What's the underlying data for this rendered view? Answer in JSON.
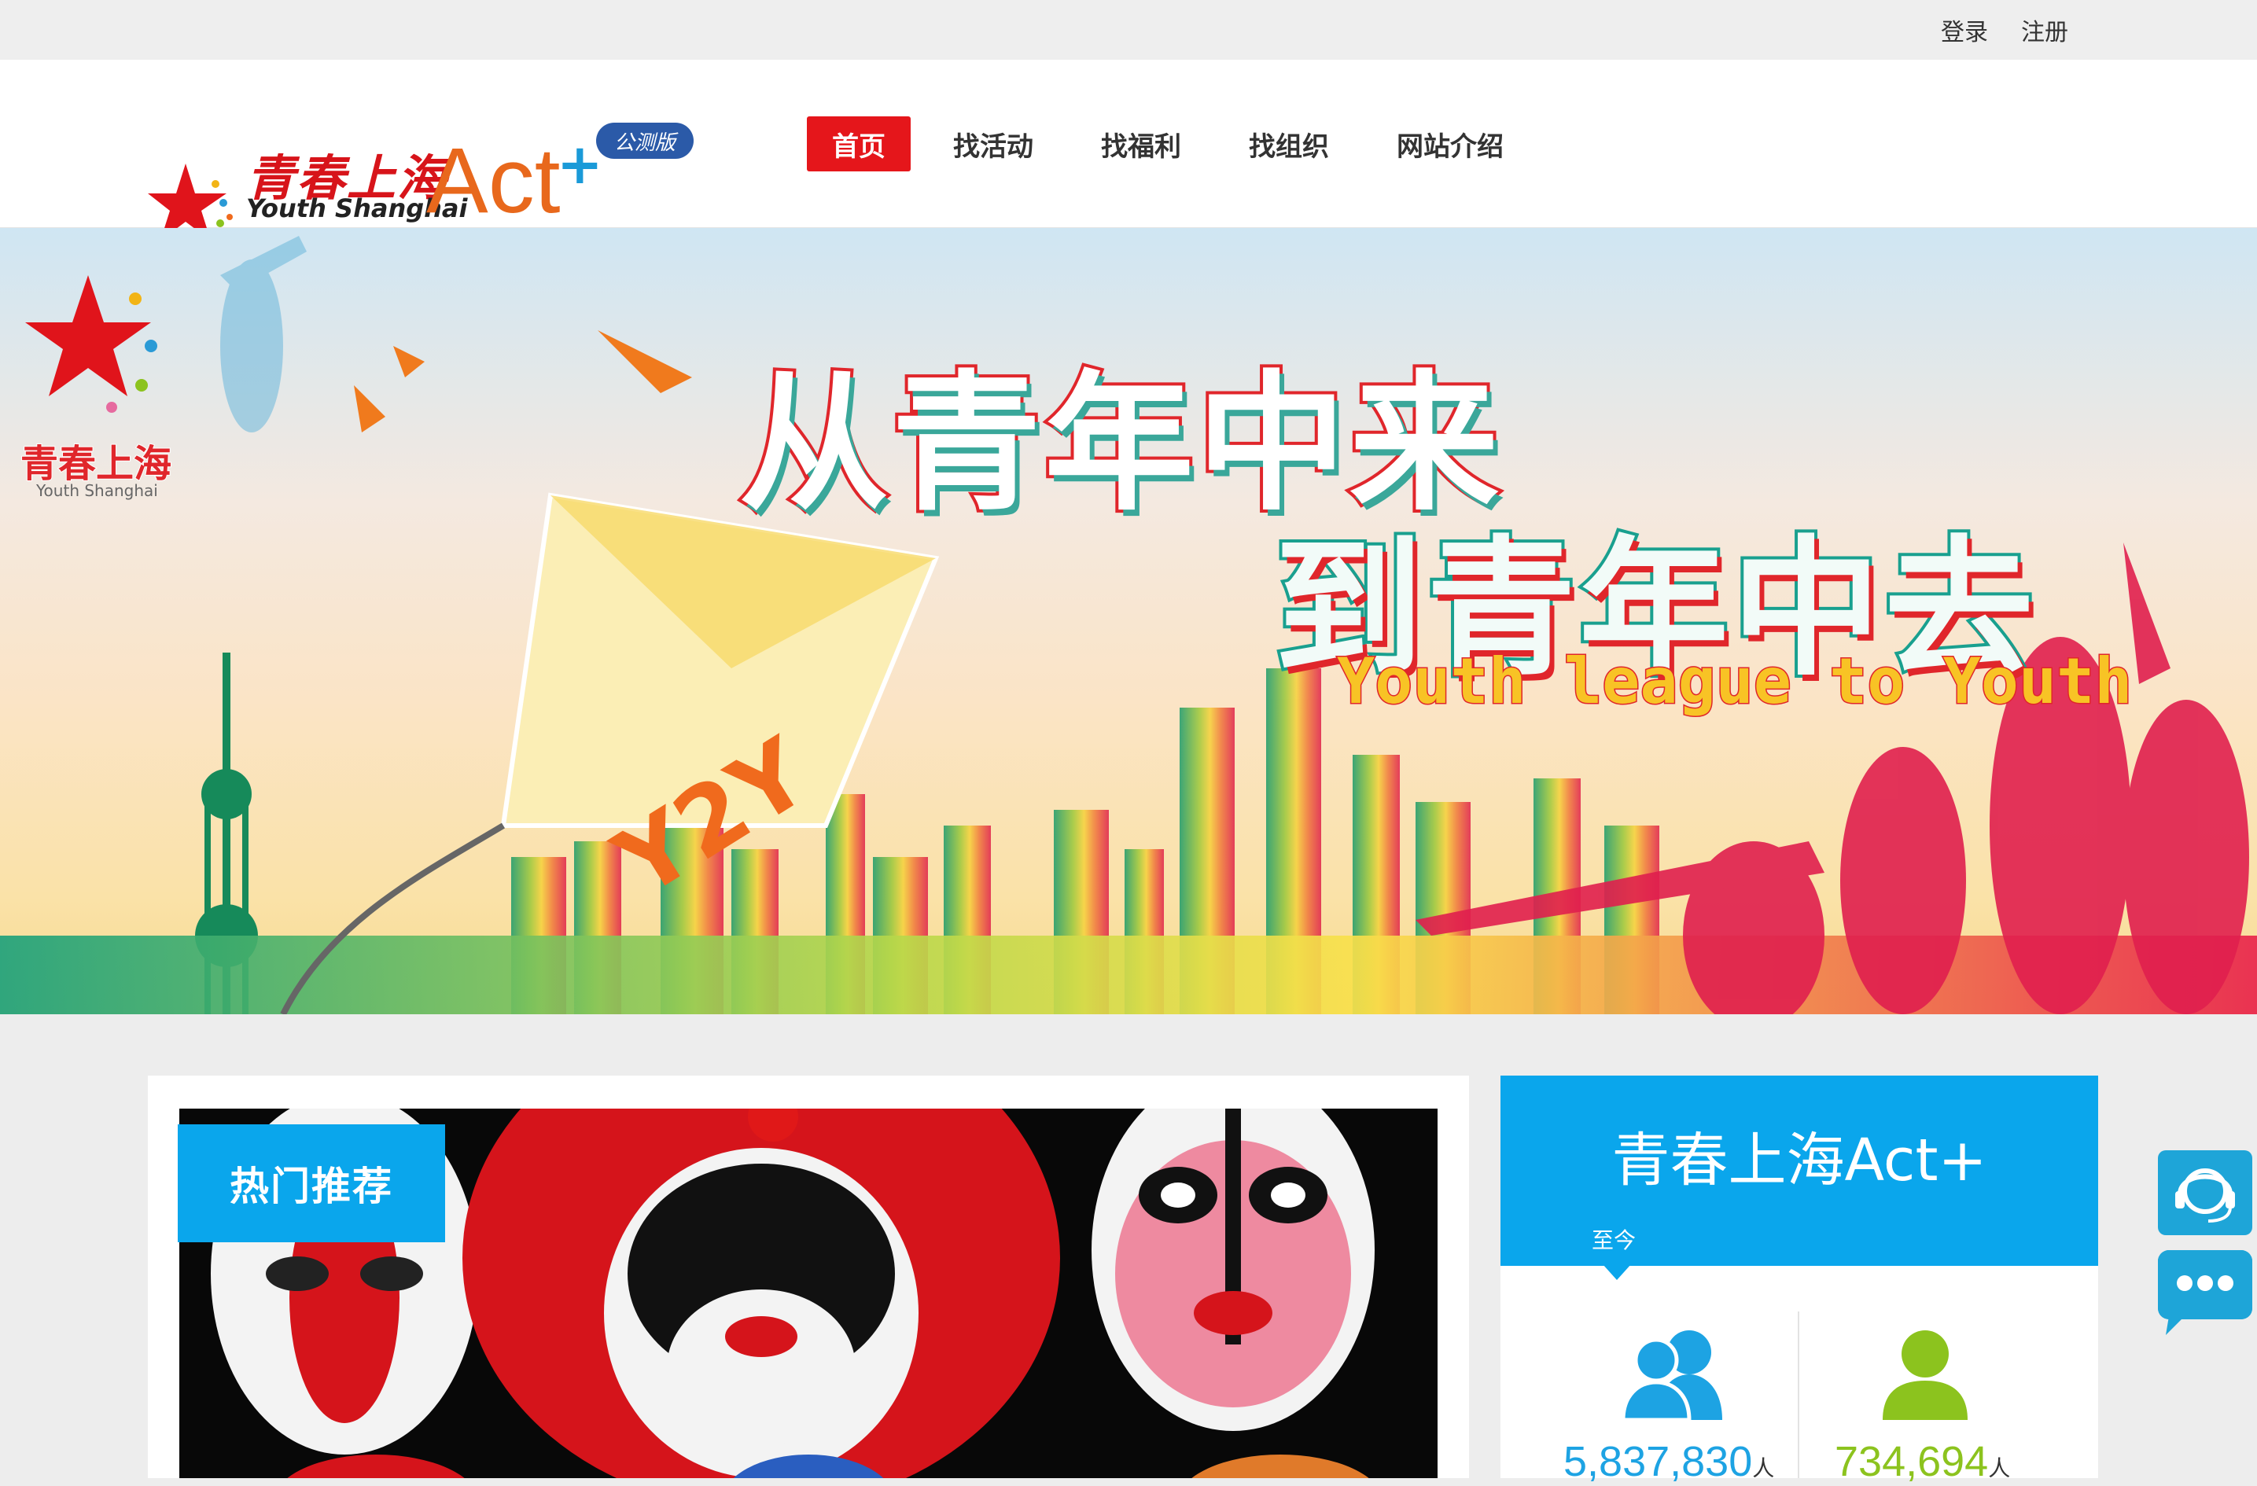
{
  "topbar": {
    "login": "登录",
    "register": "注册"
  },
  "header": {
    "logo": {
      "cn": "青春上海",
      "en": "Youth Shanghai",
      "act": "Act",
      "plus": "+",
      "beta": "公测版"
    },
    "nav": [
      {
        "label": "首页",
        "active": true
      },
      {
        "label": "找活动",
        "active": false
      },
      {
        "label": "找福利",
        "active": false
      },
      {
        "label": "找组织",
        "active": false
      },
      {
        "label": "网站介绍",
        "active": false
      }
    ]
  },
  "hero": {
    "headline1": "从青年中来",
    "headline2": "到青年中去",
    "tagline": "Youth league to Youth",
    "kite_text": "Y2Y",
    "corner_logo": {
      "cn": "青春上海",
      "en": "Youth Shanghai"
    }
  },
  "featured": {
    "tag": "热门推荐"
  },
  "stats": {
    "title": "青春上海Act+",
    "since": "至今",
    "registered_users": "5,837,830",
    "active_users": "734,694",
    "unit": "人"
  },
  "colors": {
    "accent_red": "#e5161b",
    "accent_blue": "#0aa6ec",
    "stat_blue": "#1da3e3",
    "stat_green": "#8cc31e"
  }
}
